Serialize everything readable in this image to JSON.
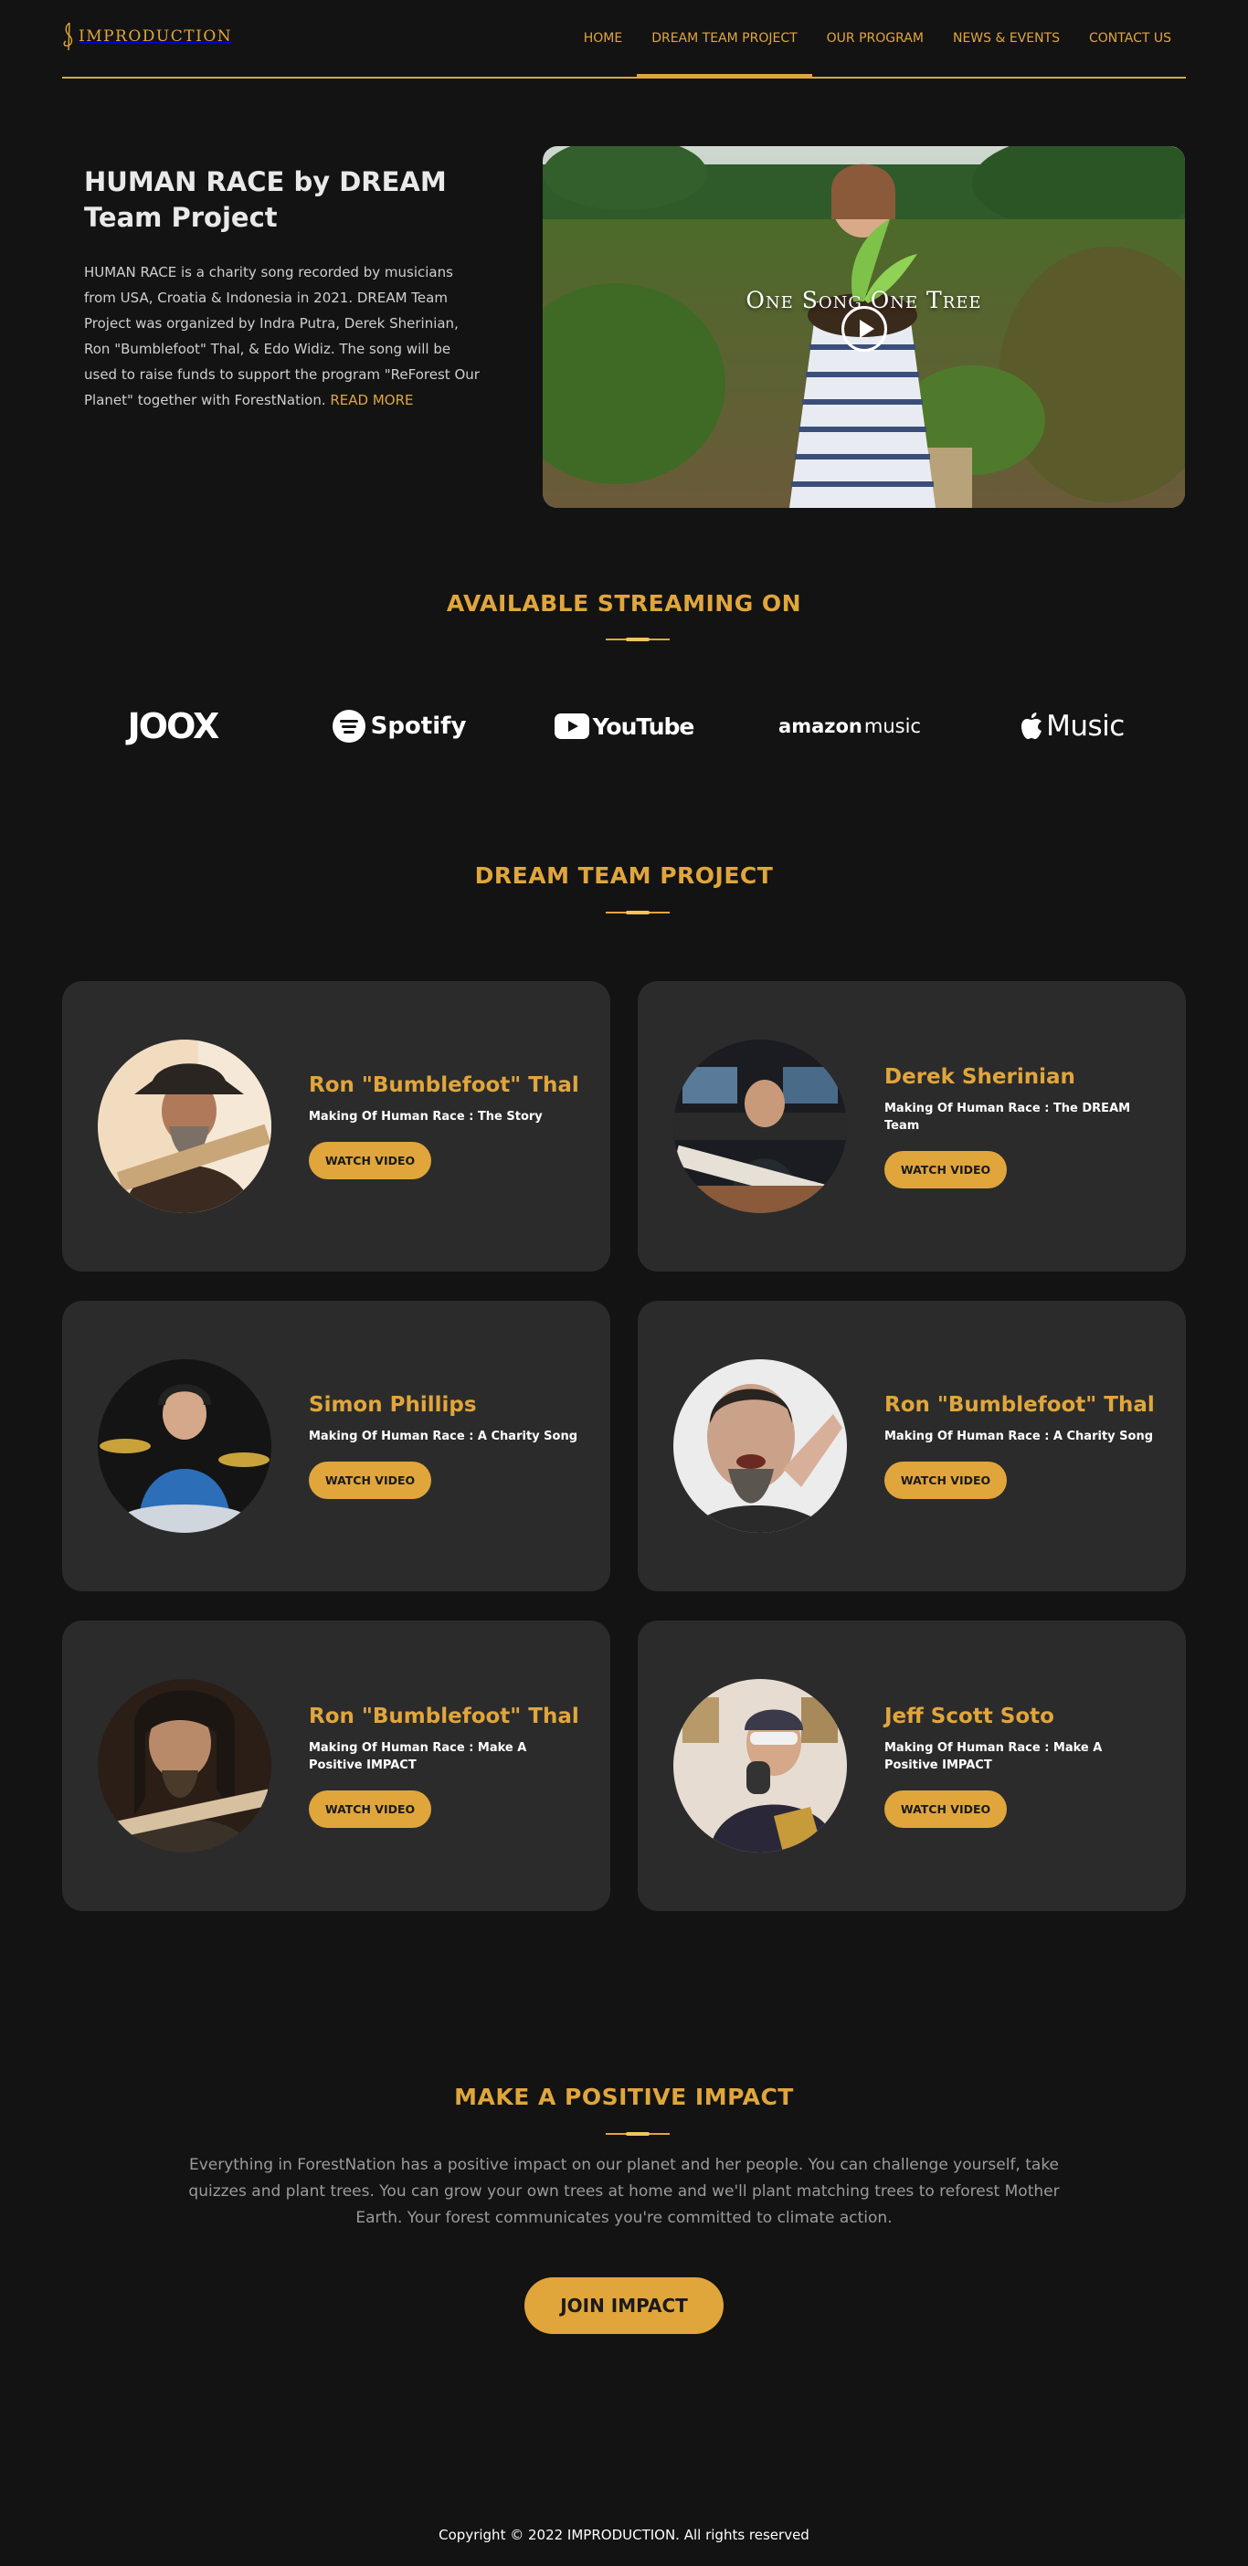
{
  "brand": {
    "logo_text": "IMPRODUCTION",
    "accent": "#e0a63c",
    "background": "#131313",
    "card_background": "#2b2b2c"
  },
  "nav": {
    "items": [
      {
        "label": "HOME"
      },
      {
        "label": "DREAM TEAM PROJECT",
        "active": true
      },
      {
        "label": "OUR PROGRAM"
      },
      {
        "label": "NEWS & EVENTS"
      },
      {
        "label": "CONTACT US"
      }
    ]
  },
  "hero": {
    "title": "HUMAN RACE by DREAM Team Project",
    "text": "HUMAN RACE is a charity song recorded by musicians from USA, Croatia & Indonesia in 2021. DREAM Team Project was organized by Indra Putra, Derek Sherinian, Ron \"Bumblefoot\" Thal, & Edo Widiz. The song will be used to raise funds to support the program \"ReForest Our Planet\" together with ForestNation.",
    "read_more": "READ MORE",
    "video_title": "One Song One Tree",
    "play_icon": "play-circle-icon"
  },
  "streaming": {
    "title": "AVAILABLE STREAMING ON",
    "services": [
      {
        "name": "JOOX"
      },
      {
        "name": "Spotify"
      },
      {
        "name": "YouTube"
      },
      {
        "name": "amazon",
        "suffix": "music"
      },
      {
        "name": "Music"
      }
    ]
  },
  "team": {
    "title": "DREAM TEAM PROJECT",
    "button_label": "WATCH VIDEO",
    "cards": [
      {
        "name": "Ron \"Bumblefoot\" Thal",
        "subtitle": "Making Of Human Race : The Story"
      },
      {
        "name": "Derek Sherinian",
        "subtitle": "Making Of Human Race : The DREAM Team"
      },
      {
        "name": "Simon Phillips",
        "subtitle": "Making Of Human Race : A Charity Song"
      },
      {
        "name": "Ron \"Bumblefoot\" Thal",
        "subtitle": "Making Of Human Race : A Charity Song"
      },
      {
        "name": "Ron \"Bumblefoot\" Thal",
        "subtitle": "Making Of Human Race : Make A Positive IMPACT"
      },
      {
        "name": "Jeff Scott Soto",
        "subtitle": "Making Of Human Race : Make A Positive IMPACT"
      }
    ]
  },
  "impact": {
    "title": "MAKE A POSITIVE IMPACT",
    "text": "Everything in ForestNation has a positive impact on our planet and her people. You can challenge yourself, take quizzes and plant trees. You can grow your own trees at home and we'll plant matching trees to reforest Mother Earth. Your forest communicates you're committed to climate action.",
    "button": "JOIN IMPACT"
  },
  "footer": {
    "copyright": "Copyright © 2022 IMPRODUCTION. All rights reserved"
  }
}
